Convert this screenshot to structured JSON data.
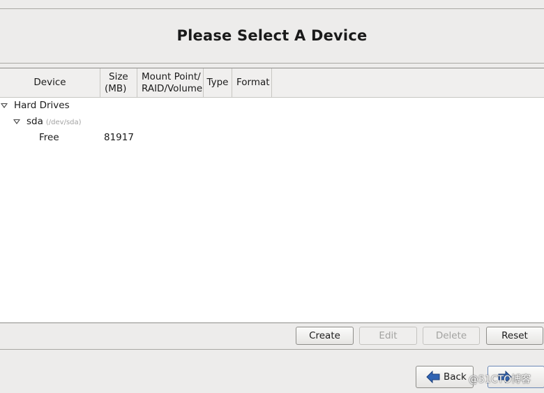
{
  "header": {
    "title": "Please Select A Device"
  },
  "columns": [
    {
      "line1": "Device",
      "line2": ""
    },
    {
      "line1": "Size",
      "line2": "(MB)"
    },
    {
      "line1": "Mount Point/",
      "line2": "RAID/Volume"
    },
    {
      "line1": "Type",
      "line2": ""
    },
    {
      "line1": "Format",
      "line2": ""
    }
  ],
  "tree": {
    "group_label": "Hard Drives",
    "disk_label": "sda",
    "disk_path": "(/dev/sda)",
    "free_label": "Free",
    "free_size": "81917"
  },
  "actions": {
    "create": "Create",
    "edit": "Edit",
    "delete": "Delete",
    "reset": "Reset"
  },
  "nav": {
    "back": "Back",
    "next": ""
  },
  "watermark": "@51CTO博客",
  "colors": {
    "arrow": "#2f63b3",
    "panel_bg": "#ffffff",
    "window_bg": "#edeceb"
  }
}
